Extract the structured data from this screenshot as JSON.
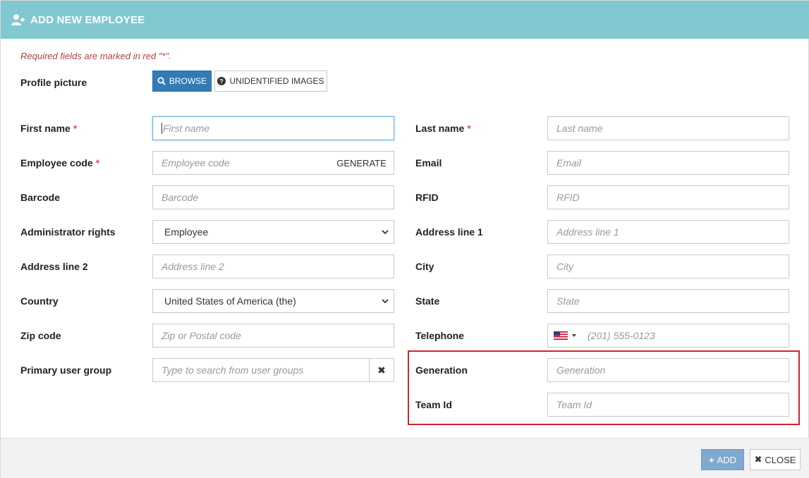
{
  "header": {
    "title": "ADD NEW EMPLOYEE",
    "icon": "user-plus-icon"
  },
  "required_note": "Required fields are marked in red \"*\".",
  "profile_picture": {
    "label": "Profile picture",
    "browse_label": "BROWSE",
    "unidentified_label": "UNIDENTIFIED IMAGES"
  },
  "required_star": "*",
  "left_fields": {
    "first_name": {
      "label": "First name",
      "placeholder": "First name"
    },
    "employee_code": {
      "label": "Employee code",
      "placeholder": "Employee code",
      "generate_label": "GENERATE"
    },
    "barcode": {
      "label": "Barcode",
      "placeholder": "Barcode"
    },
    "admin_rights": {
      "label": "Administrator rights",
      "value": "Employee"
    },
    "address2": {
      "label": "Address line 2",
      "placeholder": "Address line 2"
    },
    "country": {
      "label": "Country",
      "value": "United States of America (the)"
    },
    "zip": {
      "label": "Zip code",
      "placeholder": "Zip or Postal code"
    },
    "user_group": {
      "label": "Primary user group",
      "placeholder": "Type to search from user groups",
      "clear": "✖"
    }
  },
  "right_fields": {
    "last_name": {
      "label": "Last name",
      "placeholder": "Last name"
    },
    "email": {
      "label": "Email",
      "placeholder": "Email"
    },
    "rfid": {
      "label": "RFID",
      "placeholder": "RFID"
    },
    "address1": {
      "label": "Address line 1",
      "placeholder": "Address line 1"
    },
    "city": {
      "label": "City",
      "placeholder": "City"
    },
    "state": {
      "label": "State",
      "placeholder": "State"
    },
    "telephone": {
      "label": "Telephone",
      "placeholder": "(201) 555-0123"
    },
    "generation": {
      "label": "Generation",
      "placeholder": "Generation"
    },
    "team_id": {
      "label": "Team Id",
      "placeholder": "Team Id"
    }
  },
  "footer": {
    "add_label": "ADD",
    "close_label": "CLOSE"
  },
  "colors": {
    "header": "#82c8d0",
    "primary": "#337ab7",
    "required": "#d9534f",
    "highlight": "#d0232d"
  }
}
